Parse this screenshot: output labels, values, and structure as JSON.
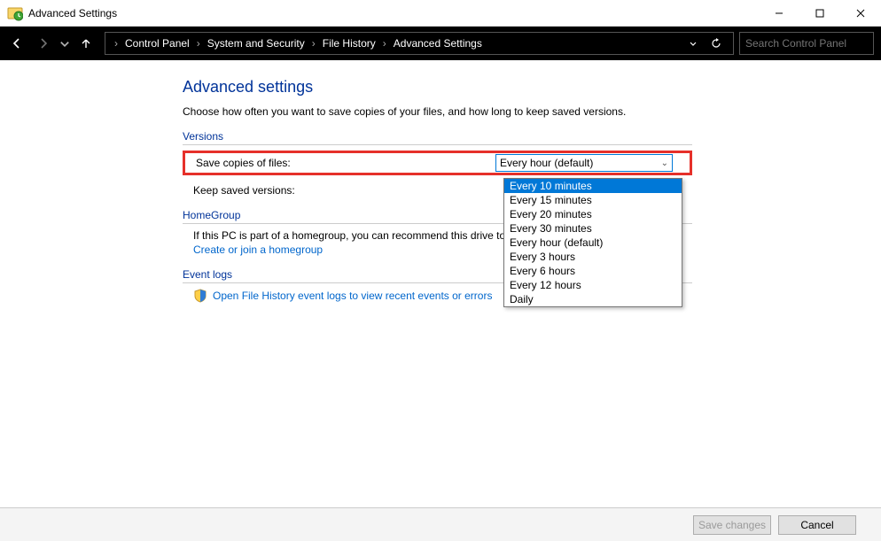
{
  "window": {
    "title": "Advanced Settings"
  },
  "breadcrumb": {
    "items": [
      "Control Panel",
      "System and Security",
      "File History",
      "Advanced Settings"
    ]
  },
  "search": {
    "placeholder": "Search Control Panel"
  },
  "page": {
    "title": "Advanced settings",
    "description": "Choose how often you want to save copies of your files, and how long to keep saved versions.",
    "sections": {
      "versions": {
        "header": "Versions",
        "save_label": "Save copies of files:",
        "save_value": "Every hour (default)",
        "keep_label": "Keep saved versions:"
      },
      "homegroup": {
        "header": "HomeGroup",
        "line1": "If this PC is part of a homegroup, you can recommend this drive to",
        "link": "Create or join a homegroup"
      },
      "eventlogs": {
        "header": "Event logs",
        "link": "Open File History event logs to view recent events or errors"
      }
    }
  },
  "dropdown": {
    "options": [
      "Every 10 minutes",
      "Every 15 minutes",
      "Every 20 minutes",
      "Every 30 minutes",
      "Every hour (default)",
      "Every 3 hours",
      "Every 6 hours",
      "Every 12 hours",
      "Daily"
    ],
    "highlighted_index": 0
  },
  "buttons": {
    "save": "Save changes",
    "cancel": "Cancel"
  }
}
